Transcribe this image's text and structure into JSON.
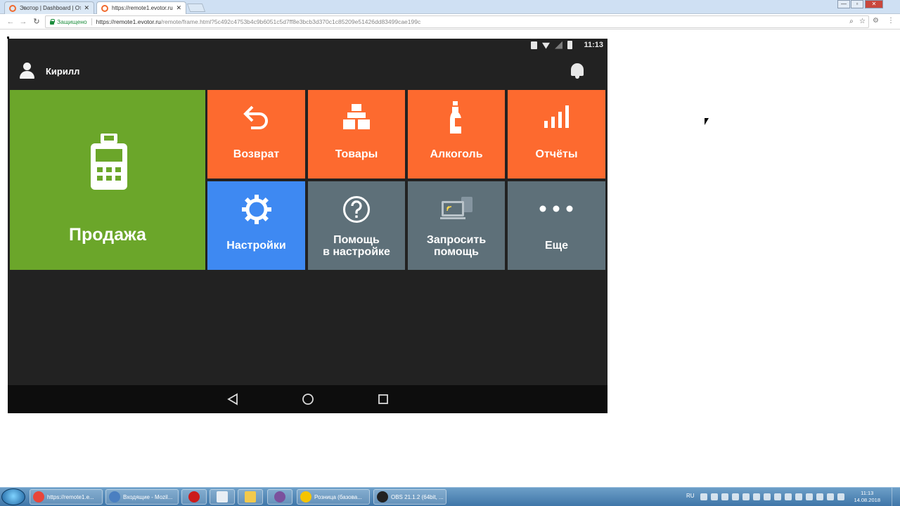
{
  "browser": {
    "tabs": [
      {
        "title": "Эвотор | Dashboard | От",
        "active": false
      },
      {
        "title": "https://remote1.evotor.ru",
        "active": true
      }
    ],
    "tab_close_glyph": "✕",
    "window_controls": {
      "minimize": "—",
      "maximize": "▫",
      "close": "✕"
    },
    "nav": {
      "back": "←",
      "forward": "→",
      "reload": "↻"
    },
    "secure_label": "Защищено",
    "url_host": "https://remote1.evotor.ru",
    "url_path": "/remote/frame.html?5c492c4753b4c9b6051c5d7ff8e3bcb3d370c1c85209e51426dd83499cae199c",
    "omnibox_icons": {
      "zoom": "⌕",
      "bookmark": "☆"
    },
    "extension_icon": "⚙",
    "menu_icon": "⋮"
  },
  "device": {
    "status_time": "11:13",
    "user_name": "Кирилл",
    "tiles": {
      "sale": "Продажа",
      "return": "Возврат",
      "goods": "Товары",
      "alcohol": "Алкоголь",
      "reports": "Отчёты",
      "settings": "Настройки",
      "help_line1": "Помощь",
      "help_line2": "в настройке",
      "request_line1": "Запросить",
      "request_line2": "помощь",
      "more": "Еще"
    },
    "colors": {
      "sale": "#6ba62a",
      "orange": "#fd6a2f",
      "blue": "#3e89f2",
      "grey": "#5e7079",
      "background": "#222222"
    }
  },
  "taskbar": {
    "items": [
      {
        "label": "https://remote1.e...",
        "color": "#e9453a"
      },
      {
        "label": "Входящие - Mozil...",
        "color": "#4a7fc1"
      },
      {
        "label": "",
        "color": "#cc1b1b"
      },
      {
        "label": "",
        "color": "#e8eef4"
      },
      {
        "label": "",
        "color": "#f2c94c"
      },
      {
        "label": "",
        "color": "#7b519d"
      },
      {
        "label": "Розница (базова...",
        "color": "#f5c400"
      },
      {
        "label": "OBS 21.1.2 (64bit, ...",
        "color": "#222222"
      }
    ],
    "lang": "RU",
    "clock_time": "11:13",
    "clock_date": "14.08.2018"
  }
}
